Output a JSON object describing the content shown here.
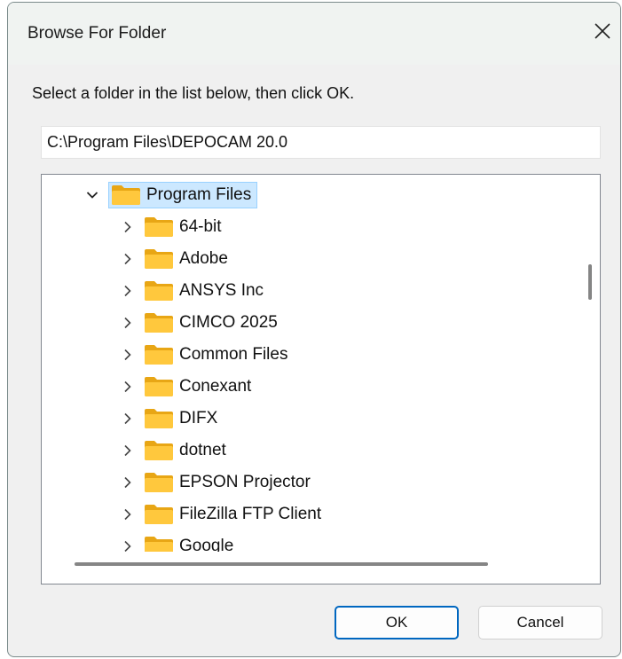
{
  "window": {
    "title": "Browse For Folder"
  },
  "instruction": "Select a folder in the list below, then click OK.",
  "path_value": "C:\\Program Files\\DEPOCAM 20.0",
  "tree": {
    "root": {
      "label": "Program Files",
      "expanded": true,
      "selected": true
    },
    "children": [
      {
        "label": "64-bit"
      },
      {
        "label": "Adobe"
      },
      {
        "label": "ANSYS Inc"
      },
      {
        "label": "CIMCO 2025"
      },
      {
        "label": "Common Files"
      },
      {
        "label": "Conexant"
      },
      {
        "label": "DIFX"
      },
      {
        "label": "dotnet"
      },
      {
        "label": "EPSON Projector"
      },
      {
        "label": "FileZilla FTP Client"
      },
      {
        "label": "Google"
      }
    ]
  },
  "buttons": {
    "ok_label": "OK",
    "cancel_label": "Cancel"
  },
  "colors": {
    "folder_fill": "#ffc83d",
    "folder_tab": "#e8a615",
    "selection_bg": "#cce8ff",
    "selection_border": "#99d1ff",
    "accent": "#0067c0"
  },
  "icons": {
    "close": "close-icon",
    "expand": "chevron-right-icon",
    "collapse": "chevron-down-icon",
    "folder": "folder-icon"
  }
}
